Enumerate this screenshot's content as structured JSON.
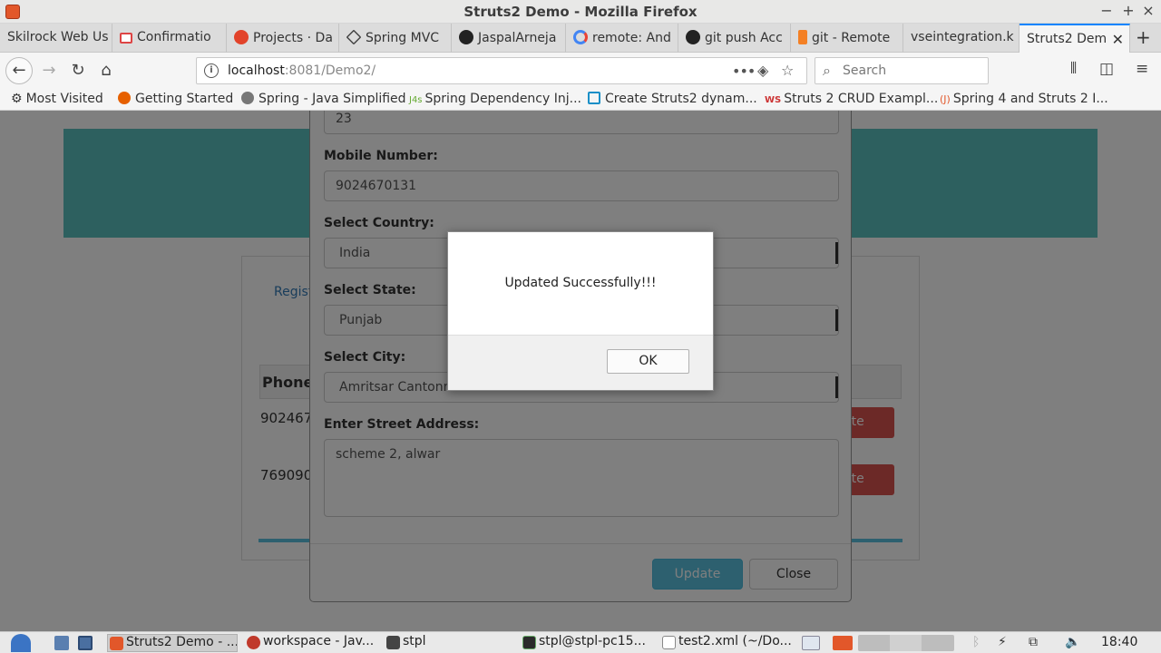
{
  "window": {
    "title": "Struts2 Demo - Mozilla Firefox"
  },
  "tabs": [
    {
      "label": "Skilrock Web Us",
      "icon": "none"
    },
    {
      "label": "Confirmatio",
      "icon": "gmail-icon"
    },
    {
      "label": "Projects · Da",
      "icon": "gitlab-icon"
    },
    {
      "label": "Spring MVC",
      "icon": "spring-icon"
    },
    {
      "label": "JaspalArneja",
      "icon": "github-icon"
    },
    {
      "label": "remote: And",
      "icon": "google-icon"
    },
    {
      "label": "git push Acc",
      "icon": "github-icon"
    },
    {
      "label": "git - Remote",
      "icon": "stackoverflow-icon"
    },
    {
      "label": "vseintegration.k",
      "icon": "none"
    },
    {
      "label": "Struts2 Dem",
      "icon": "none",
      "active": true
    }
  ],
  "navbar": {
    "url_host": "localhost",
    "url_rest": ":8081/Demo2/",
    "search_placeholder": "Search",
    "more_icon": "•••"
  },
  "bookmarks": [
    {
      "label": "Most Visited",
      "icon": "gear-icon"
    },
    {
      "label": "Getting Started",
      "icon": "firefox-icon"
    },
    {
      "label": "Spring - Java Simplified",
      "icon": "globe-icon"
    },
    {
      "label": "Spring Dependency Inj...",
      "icon": "j4s-icon"
    },
    {
      "label": "Create Struts2 dynam...",
      "icon": "bookmark-icon"
    },
    {
      "label": "Struts 2 CRUD Exampl...",
      "icon": "ws-icon"
    },
    {
      "label": "Spring 4 and Struts 2 I...",
      "icon": "j-icon"
    }
  ],
  "page": {
    "tab_link": "Regist",
    "table_header": "Phone",
    "rows": [
      {
        "phone": "902467",
        "action": "ete"
      },
      {
        "phone": "769090",
        "action": "ete"
      }
    ]
  },
  "modal": {
    "partial_value": "23",
    "fields": {
      "mobile_label": "Mobile Number:",
      "mobile_value": "9024670131",
      "country_label": "Select Country:",
      "country_value": "India",
      "state_label": "Select State:",
      "state_value": "Punjab",
      "city_label": "Select City:",
      "city_value": "Amritsar Cantonment",
      "street_label": "Enter Street Address:",
      "street_value": "scheme 2, alwar"
    },
    "update_label": "Update",
    "close_label": "Close"
  },
  "alert": {
    "message": "Updated Successfully!!!",
    "ok_label": "OK"
  },
  "taskbar": {
    "items": [
      {
        "label": "Struts2 Demo - ...",
        "active": true
      },
      {
        "label": "workspace - Jav..."
      },
      {
        "label": "stpl"
      },
      {
        "label": "stpl@stpl-pc15..."
      },
      {
        "label": "test2.xml (~/Do..."
      }
    ],
    "clock": "18:40"
  },
  "colors": {
    "banner": "#5bc0be",
    "update_button": "#5bc0de",
    "delete_button": "#d9534f",
    "active_tab_accent": "#0a84ff"
  }
}
